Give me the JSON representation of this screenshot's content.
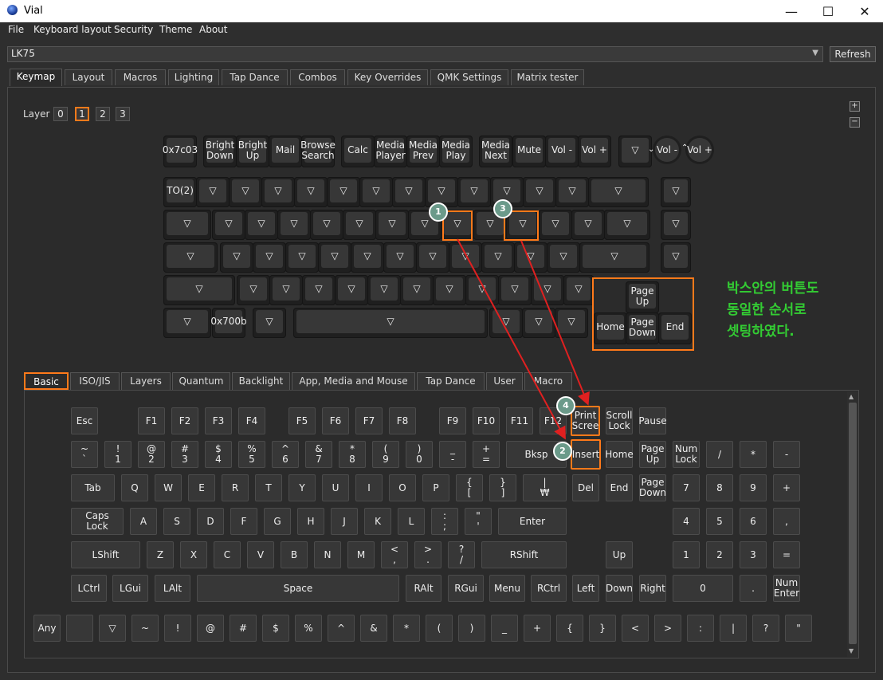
{
  "window": {
    "title": "Vial",
    "controls": {
      "minimize": "—",
      "maximize": "☐",
      "close": "✕"
    }
  },
  "menubar": [
    "File",
    "Keyboard layout",
    "Security",
    "Theme",
    "About"
  ],
  "device": {
    "selected": "LK75",
    "refresh_label": "Refresh"
  },
  "tabs": [
    "Keymap",
    "Layout",
    "Macros",
    "Lighting",
    "Tap Dance",
    "Combos",
    "Key Overrides",
    "QMK Settings",
    "Matrix tester"
  ],
  "active_tab": "Keymap",
  "layer": {
    "label": "Layer",
    "buttons": [
      "0",
      "1",
      "2",
      "3"
    ],
    "selected": "1",
    "zoom_in": "+",
    "zoom_out": "−"
  },
  "keyboard": {
    "row0": [
      "0x7c03",
      "Bright\nDown",
      "Bright\nUp",
      "Mail",
      "Browse\nSearch",
      "Calc",
      "Media\nPlayer",
      "Media\nPrev",
      "Media\nPlay",
      "Media\nNext",
      "Mute",
      "Vol -",
      "Vol +",
      "▽"
    ],
    "row0_knobs": [
      "Vol -",
      "Vol +"
    ],
    "row0_knob_arrows": [
      "⌄",
      "⌃"
    ],
    "row1": [
      "TO(2)",
      "▽",
      "▽",
      "▽",
      "▽",
      "▽",
      "▽",
      "▽",
      "▽",
      "▽",
      "▽",
      "▽",
      "▽",
      "▽",
      "▽"
    ],
    "row2": [
      "▽",
      "▽",
      "▽",
      "▽",
      "▽",
      "▽",
      "▽",
      "▽",
      "▽",
      "▽",
      "▽",
      "▽",
      "▽",
      "▽",
      "▽"
    ],
    "row3": [
      "▽",
      "▽",
      "▽",
      "▽",
      "▽",
      "▽",
      "▽",
      "▽",
      "▽",
      "▽",
      "▽",
      "▽",
      "▽",
      "▽"
    ],
    "row4": [
      "▽",
      "▽",
      "▽",
      "▽",
      "▽",
      "▽",
      "▽",
      "▽",
      "▽",
      "▽",
      "▽",
      "▽"
    ],
    "row5": [
      "▽",
      "0x700b",
      "▽",
      "▽",
      "▽",
      "▽",
      "▽"
    ],
    "nav_cluster": [
      "Page\nUp",
      "Home",
      "Page\nDown",
      "End"
    ]
  },
  "annotation_note": "박스안의 버튼도\n동일한 순서로\n셋팅하였다.",
  "markers": [
    "1",
    "2",
    "3",
    "4"
  ],
  "category_tabs": [
    "Basic",
    "ISO/JIS",
    "Layers",
    "Quantum",
    "Backlight",
    "App, Media and Mouse",
    "Tap Dance",
    "User",
    "Macro"
  ],
  "active_category": "Basic",
  "basic_keys": {
    "row1": [
      "Esc",
      "F1",
      "F2",
      "F3",
      "F4",
      "F5",
      "F6",
      "F7",
      "F8",
      "F9",
      "F10",
      "F11",
      "F12",
      "Print\nScree",
      "Scroll\nLock",
      "Pause"
    ],
    "row2": [
      "~\n`",
      "!\n1",
      "@\n2",
      "#\n3",
      "$\n4",
      "%\n5",
      "^\n6",
      "&\n7",
      "*\n8",
      "(\n9",
      ")\n0",
      "_\n-",
      "+\n=",
      "Bksp",
      "Insert",
      "Home",
      "Page\nUp",
      "Num\nLock",
      "/",
      "*",
      "-"
    ],
    "row3": [
      "Tab",
      "Q",
      "W",
      "E",
      "R",
      "T",
      "Y",
      "U",
      "I",
      "O",
      "P",
      "{\n[",
      "}\n]",
      "|\n₩",
      "Del",
      "End",
      "Page\nDown",
      "7",
      "8",
      "9",
      "+"
    ],
    "row4": [
      "Caps\nLock",
      "A",
      "S",
      "D",
      "F",
      "G",
      "H",
      "J",
      "K",
      "L",
      ":\n;",
      "\"\n'",
      "Enter",
      "4",
      "5",
      "6",
      ","
    ],
    "row5": [
      "LShift",
      "Z",
      "X",
      "C",
      "V",
      "B",
      "N",
      "M",
      "<\n,",
      ">\n.",
      "?\n/",
      "RShift",
      "Up",
      "1",
      "2",
      "3",
      "="
    ],
    "row6": [
      "LCtrl",
      "LGui",
      "LAlt",
      "Space",
      "RAlt",
      "RGui",
      "Menu",
      "RCtrl",
      "Left",
      "Down",
      "Right",
      "0",
      ".",
      "Num\nEnter"
    ],
    "row7": [
      "Any",
      "",
      "▽",
      "~",
      "!",
      "@",
      "#",
      "$",
      "%",
      "^",
      "&",
      "*",
      "(",
      ")",
      "_",
      "+",
      "{",
      "}",
      "<",
      ">",
      ":",
      "|",
      "?",
      "\""
    ]
  },
  "colors": {
    "highlight": "#ff7a1a",
    "arrow": "#e02020",
    "note": "#33cc33",
    "marker": "#6b9a8a"
  }
}
